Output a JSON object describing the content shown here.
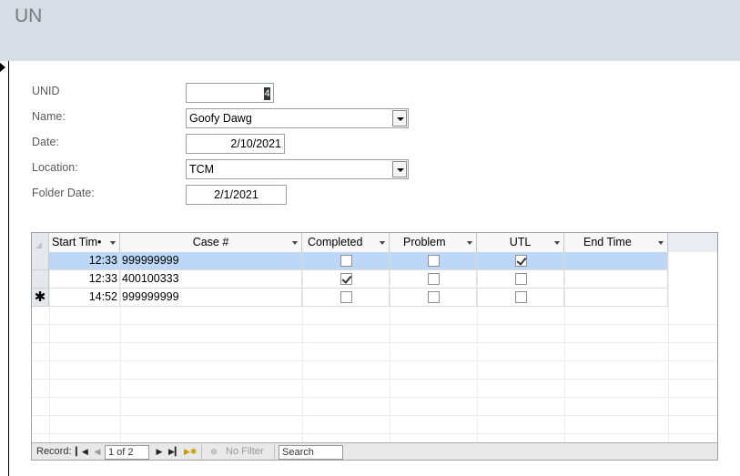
{
  "form": {
    "title": "UN"
  },
  "fields": {
    "unid": {
      "label": "UNID",
      "value": "4"
    },
    "name": {
      "label": "Name:",
      "value": "Goofy Dawg"
    },
    "date": {
      "label": "Date:",
      "value": "2/10/2021"
    },
    "location": {
      "label": "Location:",
      "value": "TCM"
    },
    "folder_date": {
      "label": "Folder Date:",
      "value": "2/1/2021"
    }
  },
  "subform": {
    "columns": [
      "Start Tim•",
      "Case #",
      "Completed",
      "Problem",
      "UTL",
      "End Time"
    ],
    "rows": [
      {
        "start": "12:33",
        "case": "999999999",
        "completed": false,
        "problem": false,
        "utl": true,
        "end": ""
      },
      {
        "start": "12:33",
        "case": "400100333",
        "completed": true,
        "problem": false,
        "utl": false,
        "end": ""
      },
      {
        "start": "14:52",
        "case": "999999999",
        "completed": false,
        "problem": false,
        "utl": false,
        "end": "",
        "new_row_marker": "✱"
      }
    ]
  },
  "navigation": {
    "record_label": "Record:",
    "position": "1 of 2",
    "filter_label": "No Filter",
    "search_placeholder": "Search"
  }
}
